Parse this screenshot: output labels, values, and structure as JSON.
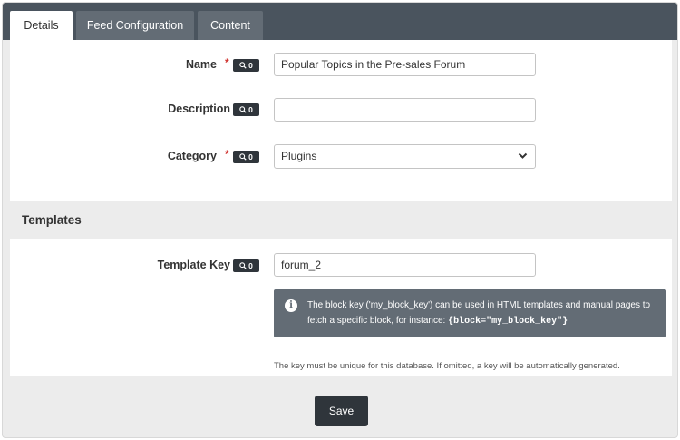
{
  "tabs": [
    {
      "label": "Details",
      "active": true
    },
    {
      "label": "Feed Configuration",
      "active": false
    },
    {
      "label": "Content",
      "active": false
    }
  ],
  "fields": {
    "name": {
      "label": "Name",
      "required": true,
      "badge_count": "0",
      "value": "Popular Topics in the Pre-sales Forum"
    },
    "description": {
      "label": "Description",
      "required": false,
      "badge_count": "0",
      "value": ""
    },
    "category": {
      "label": "Category",
      "required": true,
      "badge_count": "0",
      "value": "Plugins"
    }
  },
  "templates": {
    "section_title": "Templates",
    "template_key": {
      "label": "Template Key",
      "badge_count": "0",
      "value": "forum_2"
    },
    "info_text": "The block key ('my_block_key') can be used in HTML templates and manual pages to fetch a specific block, for instance:",
    "info_code": "{block=\"my_block_key\"}",
    "help_text": "The key must be unique for this database. If omitted, a key will be automatically generated."
  },
  "required_marker": "*",
  "save_label": "Save",
  "colors": {
    "tabbar": "#4a545e",
    "tab_inactive": "#636c75",
    "badge": "#2f353b",
    "required": "#d0312d",
    "info_bg": "#636c75"
  }
}
